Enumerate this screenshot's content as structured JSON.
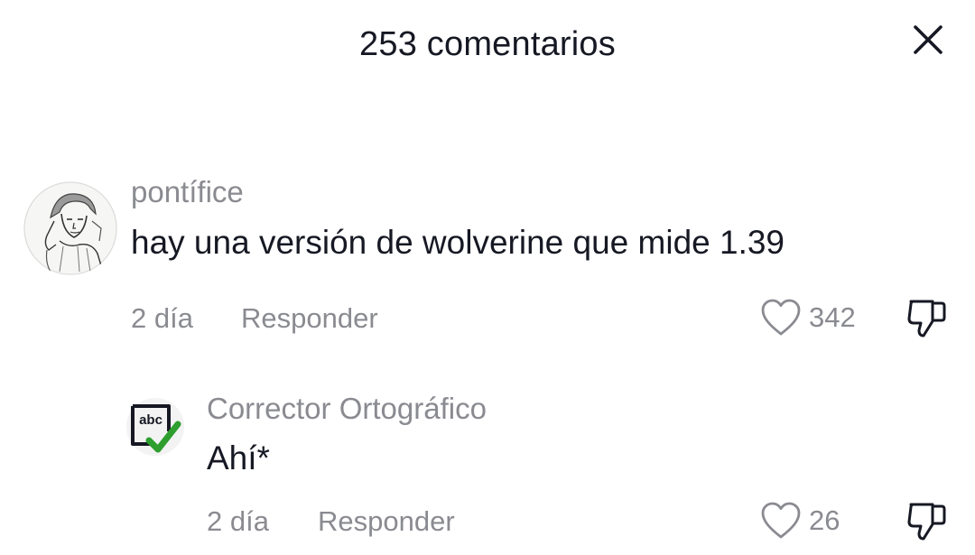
{
  "header": {
    "title": "253 comentarios",
    "close_icon": "close-icon"
  },
  "comments": [
    {
      "username": "pontífice",
      "text": "hay una versión de wolverine que mide 1.39",
      "date": "2 día",
      "reply_label": "Responder",
      "likes": "342",
      "avatar_icon": "sketch-portrait-avatar"
    },
    {
      "username": "Corrector Ortográfico",
      "text": "Ahí*",
      "date": "2 día",
      "reply_label": "Responder",
      "likes": "26",
      "avatar_icon": "abc-checkmark-avatar",
      "avatar_text": "abc",
      "check_color": "#2e9e2e"
    }
  ],
  "colors": {
    "primary_text": "#161823",
    "secondary_text": "#8a8b91",
    "background": "#ffffff"
  }
}
